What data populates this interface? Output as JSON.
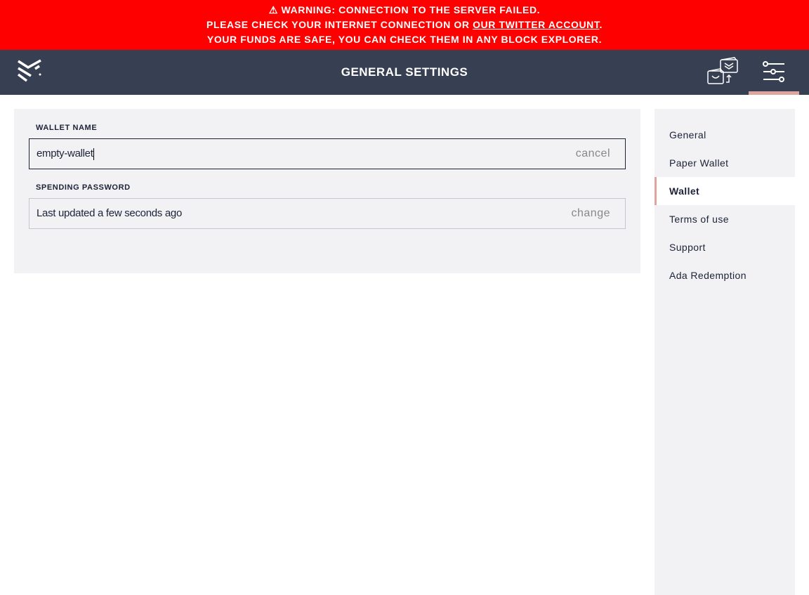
{
  "banner": {
    "line1": "WARNING: CONNECTION TO THE SERVER FAILED.",
    "line2_pre": "PLEASE CHECK YOUR INTERNET CONNECTION OR ",
    "line2_link": "OUR TWITTER ACCOUNT",
    "line2_post": ".",
    "line3": "YOUR FUNDS ARE SAFE, YOU CAN CHECK THEM IN ANY BLOCK EXPLORER.",
    "color": "#ff0000"
  },
  "header": {
    "title": "GENERAL SETTINGS",
    "color": "#373f52"
  },
  "form": {
    "wallet_name_label": "WALLET NAME",
    "wallet_name_value": "empty-wallet",
    "cancel": "cancel",
    "password_label": "SPENDING PASSWORD",
    "password_value": "Last updated a few seconds ago",
    "change": "change"
  },
  "sidebar": {
    "items": [
      {
        "label": "General"
      },
      {
        "label": "Paper Wallet"
      },
      {
        "label": "Wallet",
        "active": true
      },
      {
        "label": "Terms of use"
      },
      {
        "label": "Support"
      },
      {
        "label": "Ada Redemption"
      }
    ],
    "accent": "#dfa49b"
  }
}
